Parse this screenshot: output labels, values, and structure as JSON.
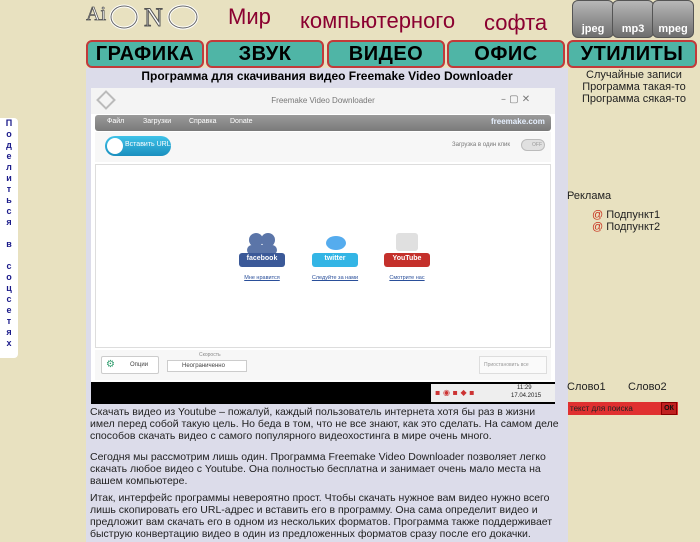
{
  "share": {
    "letters": [
      "П",
      "о",
      "д",
      "е",
      "л",
      "и",
      "т",
      "ь",
      "с",
      "я",
      "",
      "в",
      "",
      "с",
      "о",
      "ц",
      "с",
      "е",
      "т",
      "я",
      "х"
    ]
  },
  "header": {
    "logo_text": "AiONE",
    "words": [
      "Мир",
      "компьютерного",
      "софта"
    ],
    "icons": [
      {
        "name": "jpeg-icon",
        "label": "jpeg"
      },
      {
        "name": "mp3-icon",
        "label": "mp3"
      },
      {
        "name": "mpeg-icon",
        "label": "mpeg"
      }
    ]
  },
  "nav": [
    "ГРАФИКА",
    "ЗВУК",
    "ВИДЕО",
    "ОФИС",
    "УТИЛИТЫ"
  ],
  "article": {
    "title": "Программа для скачивания видео Freemake Video Downloader",
    "paragraphs": [
      "Скачать видео из Youtube – пожалуй, каждый пользователь интернета хотя бы раз в жизни имел перед собой такую цель. Но беда в том, что не все знают, как это сделать. На самом деле способов скачать видео с самого популярного видеохостинга в мире очень много.",
      "Сегодня мы рассмотрим лишь один. Программа Freemake Video Downloader позволяет легко скачать любое видео с Youtube. Она полностью бесплатна и занимает очень мало места на вашем компьютере.",
      "Итак, интерфейс программы невероятно прост. Чтобы скачать нужное вам видео нужно всего лишь скопировать его URL-адрес и вставить его в программу. Она сама определит видео и предложит вам скачать его в одном из нескольких форматов. Программа также поддерживает быструю конвертацию видео в один из предложенных форматов сразу после его докачки."
    ]
  },
  "app": {
    "window_title": "Freemake Video Downloader",
    "menu": [
      "Файл",
      "Загрузки",
      "Справка",
      "Donate"
    ],
    "brand": "freemake.com",
    "paste_url": "Вставить URL",
    "one_click": "Загрузка в один клик",
    "toggle": "OFF",
    "social": [
      {
        "name": "facebook",
        "link": "Мне нравится",
        "color": "#3b5998"
      },
      {
        "name": "twitter",
        "link": "Следуйте за нами",
        "color": "#33b5e5"
      },
      {
        "name": "YouTube",
        "link": "Смотрите нас",
        "color": "#c4302b"
      }
    ],
    "options": "Опции",
    "speed_label": "Скорость",
    "speed_value": "Неограниченно",
    "pause_all": "Приостановить все",
    "clock_time": "11:29",
    "clock_date": "17.04.2015"
  },
  "sidebar": {
    "links": [
      "Случайные записи",
      "Программа такая-то",
      "Программа сякая-то"
    ],
    "ad_title": "Реклама",
    "subitems": [
      "Подпункт1",
      "Подпункт2"
    ],
    "words": [
      "Слово1",
      "Слово2"
    ],
    "search_placeholder": "текст для поиска",
    "search_button": "ОК"
  }
}
